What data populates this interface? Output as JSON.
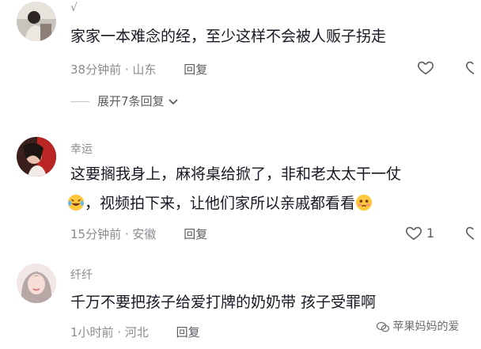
{
  "comments": [
    {
      "username": "√",
      "lines": [
        "家家一本难念的经，至少这样不会被人贩子拐走"
      ],
      "time": "38分钟前",
      "location": "山东",
      "reply_label": "回复",
      "likes": ""
    },
    {
      "username": "幸运",
      "lines": [
        "这要搁我身上，麻将桌给掀了，非和老太太干一仗",
        "，视频拍下来，让他们家所以亲戚都看看"
      ],
      "time": "15分钟前",
      "location": "安徽",
      "reply_label": "回复",
      "likes": "1"
    },
    {
      "username": "纤纤",
      "lines": [
        "千万不要把孩子给爱打牌的奶奶带 孩子受罪啊"
      ],
      "time": "1小时前",
      "location": "河北",
      "reply_label": "回复",
      "likes": ""
    }
  ],
  "expand_replies": "展开7条回复",
  "watermark": "苹果妈妈的爱",
  "icons": {
    "like": "heart-outline-icon",
    "expand": "chevron-down-icon",
    "emoji_1": "laughing-tears-emoji",
    "emoji_2": "flushed-face-emoji"
  },
  "colors": {
    "text": "#161823",
    "secondary": "#8a8b91",
    "background": "#ffffff"
  }
}
